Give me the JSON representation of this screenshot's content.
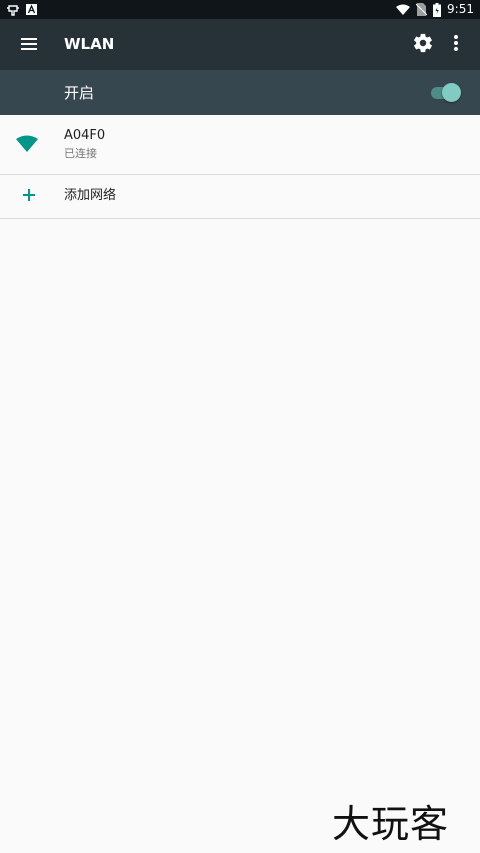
{
  "status_bar": {
    "time": "9:51",
    "icons": [
      "debug-icon",
      "a-icon",
      "wifi-icon",
      "no-sim-icon",
      "battery-icon"
    ]
  },
  "toolbar": {
    "title": "WLAN",
    "menu_icon": "hamburger-menu-icon",
    "settings_icon": "gear-icon",
    "more_icon": "more-vert-icon"
  },
  "switch_bar": {
    "label": "开启",
    "enabled": true
  },
  "networks": [
    {
      "ssid": "A04F0",
      "status": "已连接",
      "icon": "wifi-signal-icon"
    }
  ],
  "add_network": {
    "label": "添加网络",
    "icon": "plus-icon"
  },
  "watermark": "大玩客",
  "colors": {
    "toolbar": "#263238",
    "switch_bar": "#37474f",
    "accent": "#009688",
    "toggle_thumb": "#80cbc4"
  }
}
